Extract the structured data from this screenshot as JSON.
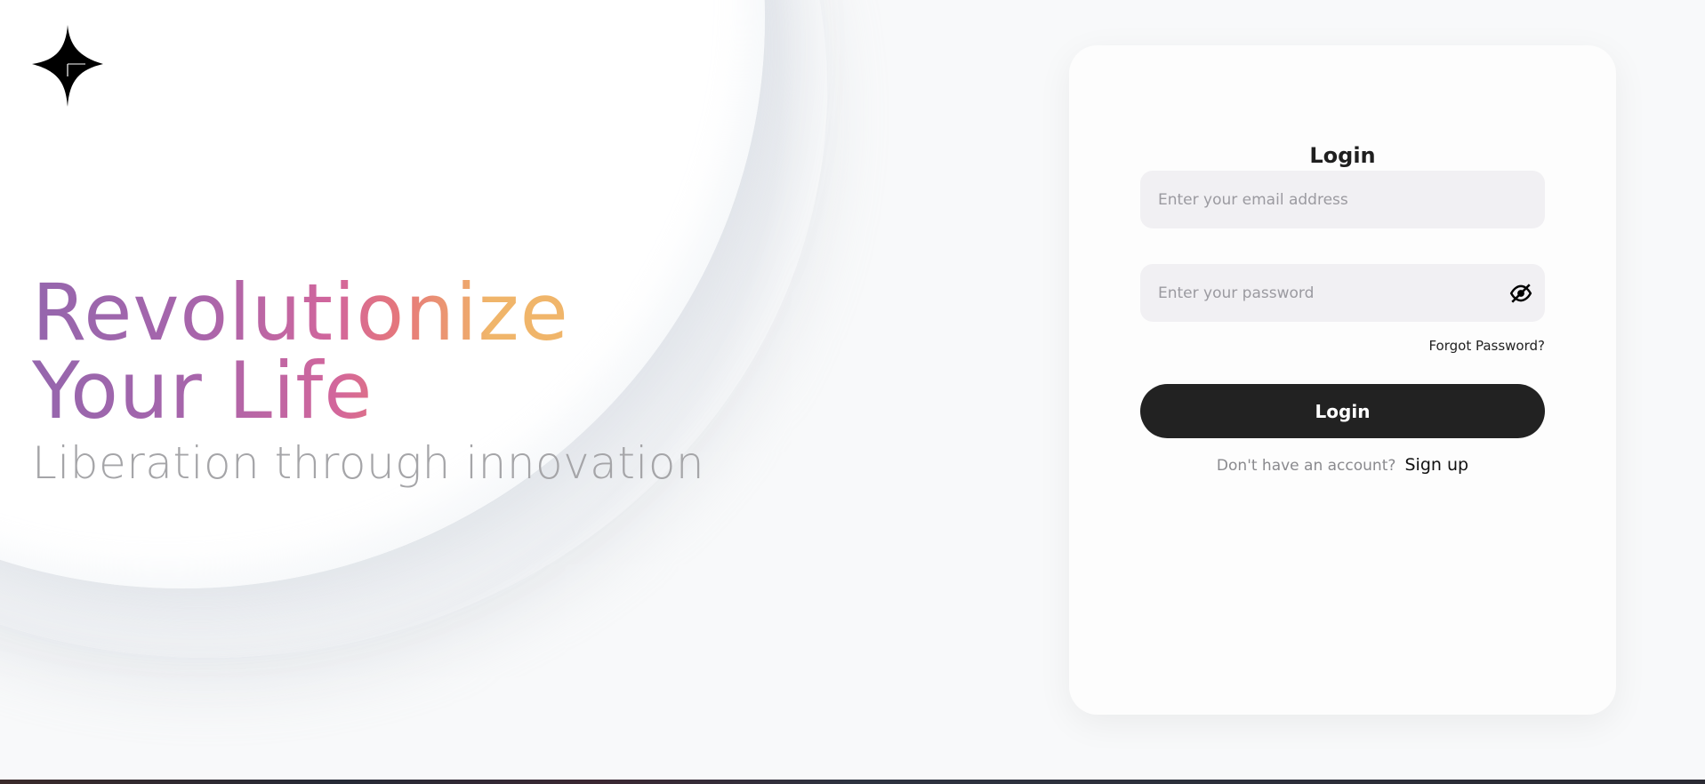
{
  "hero": {
    "title_line1": "Revolutionize",
    "title_line2": "Your Life",
    "subtitle": "Liberation through innovation",
    "gradient_colors": [
      "#9566ad",
      "#d2669c",
      "#f0b56a"
    ]
  },
  "logo": {
    "icon": "four-point-star-icon",
    "color": "#000000"
  },
  "login_card": {
    "title": "Login",
    "email": {
      "placeholder": "Enter your email address",
      "value": ""
    },
    "password": {
      "placeholder": "Enter your password",
      "value": "",
      "toggle_icon": "eye-off-icon"
    },
    "forgot_label": "Forgot Password?",
    "login_button_label": "Login",
    "signup_prompt": "Don't have an account?",
    "signup_label": "Sign up"
  },
  "colors": {
    "background": "#f8f9fa",
    "button": "#222222",
    "field_bg": "#f1f0f3",
    "subtitle": "#a5a5a8"
  }
}
